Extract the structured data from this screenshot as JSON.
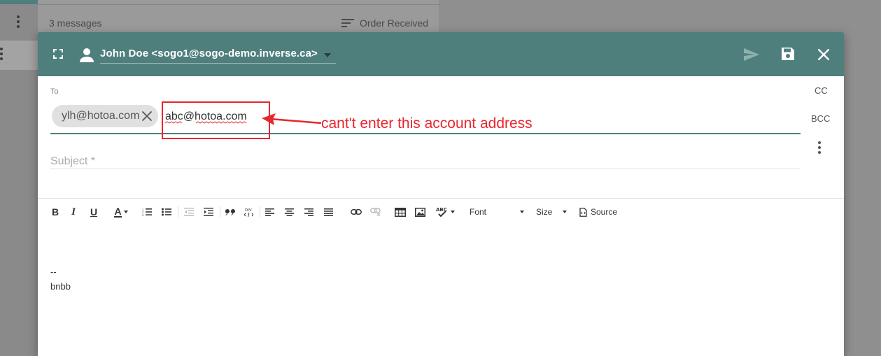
{
  "background": {
    "message_count": "3 messages",
    "sort_label": "Order Received"
  },
  "header": {
    "from_identity": "John Doe <sogo1@sogo-demo.inverse.ca>",
    "accent_color": "#4f7f7c"
  },
  "recipients": {
    "to_label": "To",
    "to_chips": [
      "ylh@hotoa.com"
    ],
    "to_typed_value": "abc@hotoa.com",
    "cc_label": "CC",
    "bcc_label": "BCC"
  },
  "subject": {
    "placeholder": "Subject *",
    "value": ""
  },
  "toolbar": {
    "bold": "B",
    "italic": "I",
    "underline": "U",
    "text_color": "A",
    "font_label": "Font",
    "size_label": "Size",
    "source_label": "Source",
    "spellcheck_label": "ABC"
  },
  "body": {
    "signature_separator": "--",
    "signature_text": "bnbb"
  },
  "annotation": {
    "text": "cant't enter this account address",
    "color": "#e8262e"
  }
}
